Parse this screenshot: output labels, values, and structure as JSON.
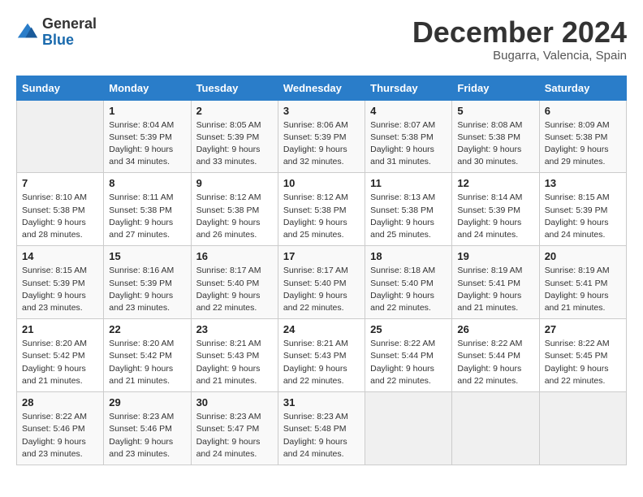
{
  "header": {
    "logo_general": "General",
    "logo_blue": "Blue",
    "month_title": "December 2024",
    "location": "Bugarra, Valencia, Spain"
  },
  "calendar": {
    "days_of_week": [
      "Sunday",
      "Monday",
      "Tuesday",
      "Wednesday",
      "Thursday",
      "Friday",
      "Saturday"
    ],
    "weeks": [
      [
        {
          "day": "",
          "empty": true
        },
        {
          "day": "",
          "empty": true
        },
        {
          "day": "",
          "empty": true
        },
        {
          "day": "",
          "empty": true
        },
        {
          "day": "",
          "empty": true
        },
        {
          "day": "",
          "empty": true
        },
        {
          "day": "",
          "empty": true
        }
      ]
    ],
    "cells": [
      {
        "num": "1",
        "sunrise": "8:04 AM",
        "sunset": "5:39 PM",
        "daylight": "9 hours and 34 minutes."
      },
      {
        "num": "2",
        "sunrise": "8:05 AM",
        "sunset": "5:39 PM",
        "daylight": "9 hours and 33 minutes."
      },
      {
        "num": "3",
        "sunrise": "8:06 AM",
        "sunset": "5:39 PM",
        "daylight": "9 hours and 32 minutes."
      },
      {
        "num": "4",
        "sunrise": "8:07 AM",
        "sunset": "5:38 PM",
        "daylight": "9 hours and 31 minutes."
      },
      {
        "num": "5",
        "sunrise": "8:08 AM",
        "sunset": "5:38 PM",
        "daylight": "9 hours and 30 minutes."
      },
      {
        "num": "6",
        "sunrise": "8:09 AM",
        "sunset": "5:38 PM",
        "daylight": "9 hours and 29 minutes."
      },
      {
        "num": "7",
        "sunrise": "8:10 AM",
        "sunset": "5:38 PM",
        "daylight": "9 hours and 28 minutes."
      },
      {
        "num": "8",
        "sunrise": "8:11 AM",
        "sunset": "5:38 PM",
        "daylight": "9 hours and 27 minutes."
      },
      {
        "num": "9",
        "sunrise": "8:12 AM",
        "sunset": "5:38 PM",
        "daylight": "9 hours and 26 minutes."
      },
      {
        "num": "10",
        "sunrise": "8:12 AM",
        "sunset": "5:38 PM",
        "daylight": "9 hours and 25 minutes."
      },
      {
        "num": "11",
        "sunrise": "8:13 AM",
        "sunset": "5:38 PM",
        "daylight": "9 hours and 25 minutes."
      },
      {
        "num": "12",
        "sunrise": "8:14 AM",
        "sunset": "5:39 PM",
        "daylight": "9 hours and 24 minutes."
      },
      {
        "num": "13",
        "sunrise": "8:15 AM",
        "sunset": "5:39 PM",
        "daylight": "9 hours and 24 minutes."
      },
      {
        "num": "14",
        "sunrise": "8:15 AM",
        "sunset": "5:39 PM",
        "daylight": "9 hours and 23 minutes."
      },
      {
        "num": "15",
        "sunrise": "8:16 AM",
        "sunset": "5:39 PM",
        "daylight": "9 hours and 23 minutes."
      },
      {
        "num": "16",
        "sunrise": "8:17 AM",
        "sunset": "5:40 PM",
        "daylight": "9 hours and 22 minutes."
      },
      {
        "num": "17",
        "sunrise": "8:17 AM",
        "sunset": "5:40 PM",
        "daylight": "9 hours and 22 minutes."
      },
      {
        "num": "18",
        "sunrise": "8:18 AM",
        "sunset": "5:40 PM",
        "daylight": "9 hours and 22 minutes."
      },
      {
        "num": "19",
        "sunrise": "8:19 AM",
        "sunset": "5:41 PM",
        "daylight": "9 hours and 21 minutes."
      },
      {
        "num": "20",
        "sunrise": "8:19 AM",
        "sunset": "5:41 PM",
        "daylight": "9 hours and 21 minutes."
      },
      {
        "num": "21",
        "sunrise": "8:20 AM",
        "sunset": "5:42 PM",
        "daylight": "9 hours and 21 minutes."
      },
      {
        "num": "22",
        "sunrise": "8:20 AM",
        "sunset": "5:42 PM",
        "daylight": "9 hours and 21 minutes."
      },
      {
        "num": "23",
        "sunrise": "8:21 AM",
        "sunset": "5:43 PM",
        "daylight": "9 hours and 21 minutes."
      },
      {
        "num": "24",
        "sunrise": "8:21 AM",
        "sunset": "5:43 PM",
        "daylight": "9 hours and 22 minutes."
      },
      {
        "num": "25",
        "sunrise": "8:22 AM",
        "sunset": "5:44 PM",
        "daylight": "9 hours and 22 minutes."
      },
      {
        "num": "26",
        "sunrise": "8:22 AM",
        "sunset": "5:44 PM",
        "daylight": "9 hours and 22 minutes."
      },
      {
        "num": "27",
        "sunrise": "8:22 AM",
        "sunset": "5:45 PM",
        "daylight": "9 hours and 22 minutes."
      },
      {
        "num": "28",
        "sunrise": "8:22 AM",
        "sunset": "5:46 PM",
        "daylight": "9 hours and 23 minutes."
      },
      {
        "num": "29",
        "sunrise": "8:23 AM",
        "sunset": "5:46 PM",
        "daylight": "9 hours and 23 minutes."
      },
      {
        "num": "30",
        "sunrise": "8:23 AM",
        "sunset": "5:47 PM",
        "daylight": "9 hours and 24 minutes."
      },
      {
        "num": "31",
        "sunrise": "8:23 AM",
        "sunset": "5:48 PM",
        "daylight": "9 hours and 24 minutes."
      }
    ],
    "start_dow": 0,
    "labels": {
      "sunrise": "Sunrise:",
      "sunset": "Sunset:",
      "daylight": "Daylight:"
    }
  }
}
